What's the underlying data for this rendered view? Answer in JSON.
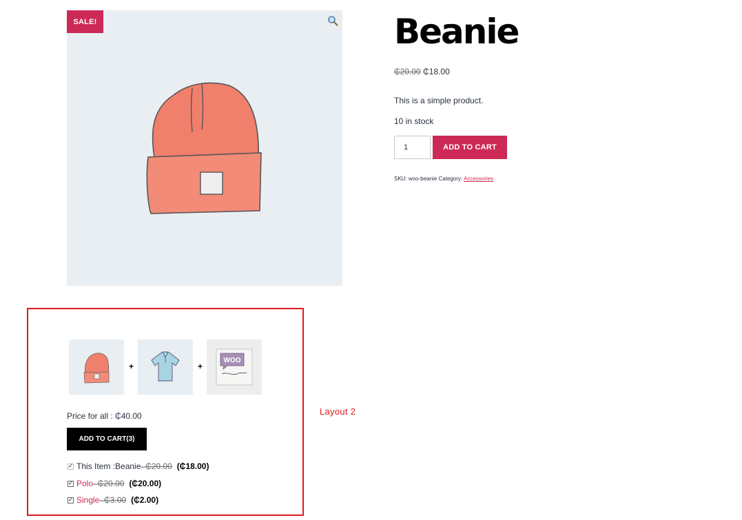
{
  "gallery": {
    "sale_badge": "SALE!",
    "zoom_icon": "magnifier-icon"
  },
  "product": {
    "title": "Beanie",
    "price_old": "₵20.00",
    "price_new": "₵18.00",
    "short_description": "This is a simple product.",
    "stock": "10 in stock",
    "quantity": "1",
    "add_to_cart_label": "ADD TO CART",
    "sku_label": "SKU:",
    "sku": "woo-beanie",
    "category_label": "Category:",
    "category": "Accessories"
  },
  "bundle": {
    "thumbnails": [
      "beanie",
      "polo",
      "single"
    ],
    "plus": "+",
    "price_for_all_label": "Price for all :",
    "price_for_all": "₵40.00",
    "add_to_cart_label": "ADD TO CART(3)",
    "items": [
      {
        "prefix": "This Item : ",
        "name": "Beanie",
        "sep": " – ",
        "old": "₵20.00",
        "new": "(₵18.00)"
      },
      {
        "prefix": "",
        "name": "Polo",
        "sep": " – ",
        "old": "₵20.00",
        "new": "(₵20.00)"
      },
      {
        "prefix": "",
        "name": "Single",
        "sep": " – ",
        "old": "₵3.00",
        "new": "(₵2.00)"
      }
    ]
  },
  "annotation": {
    "label": "Layout 2"
  },
  "colors": {
    "accent": "#cc2956",
    "annotation": "#e01a1a",
    "beanie": "#f07f6c"
  }
}
